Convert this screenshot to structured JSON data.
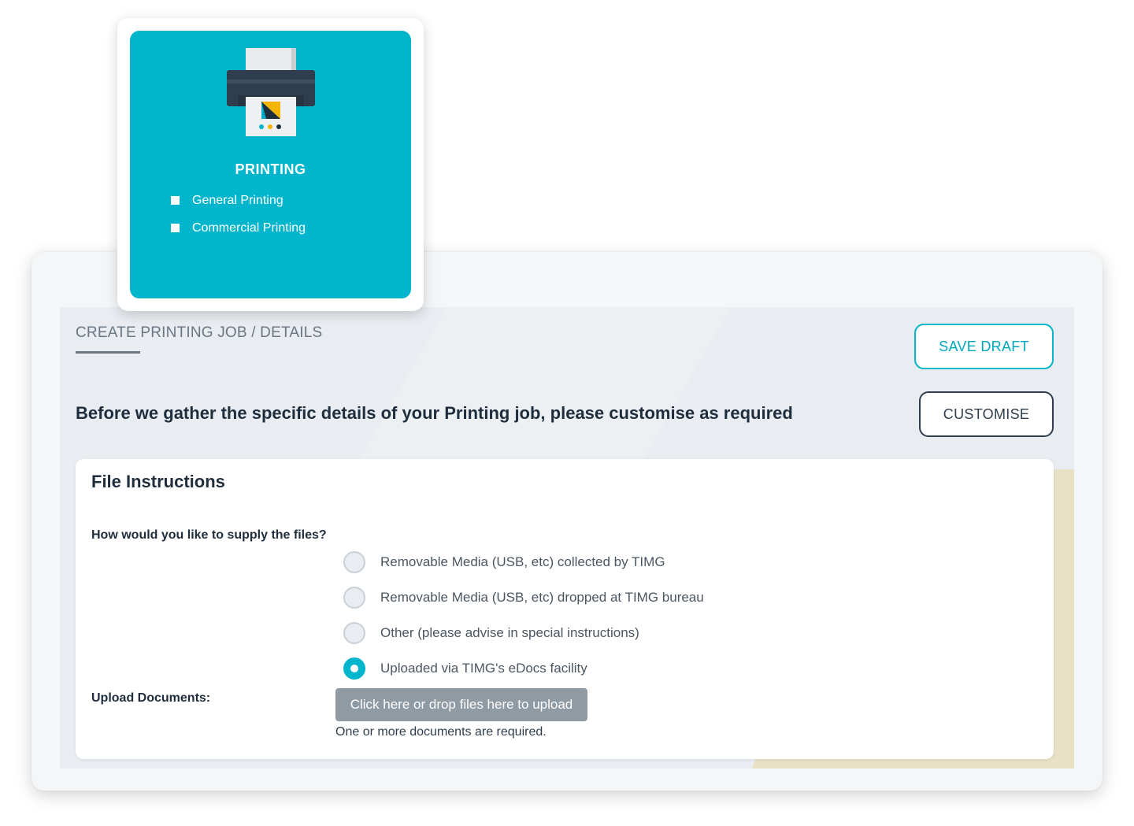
{
  "card": {
    "title": "PRINTING",
    "items": [
      "General Printing",
      "Commercial Printing"
    ],
    "icon": "printer-icon",
    "color": "#00b5cc"
  },
  "header": {
    "breadcrumb": "CREATE PRINTING JOB / DETAILS",
    "save_draft_label": "SAVE DRAFT",
    "customise_label": "CUSTOMISE",
    "intro": "Before we gather the specific details of your Printing job, please customise as required"
  },
  "file_instructions": {
    "title": "File Instructions",
    "supply_question": "How would you like to supply the files?",
    "options": [
      {
        "label": "Removable Media (USB, etc) collected by TIMG",
        "selected": false
      },
      {
        "label": "Removable Media (USB, etc) dropped at TIMG bureau",
        "selected": false
      },
      {
        "label": "Other (please advise in special instructions)",
        "selected": false
      },
      {
        "label": "Uploaded via TIMG's eDocs facility",
        "selected": true
      }
    ],
    "upload_label": "Upload Documents:",
    "upload_button": "Click here or drop files here to upload",
    "upload_hint": "One or more documents are required."
  }
}
